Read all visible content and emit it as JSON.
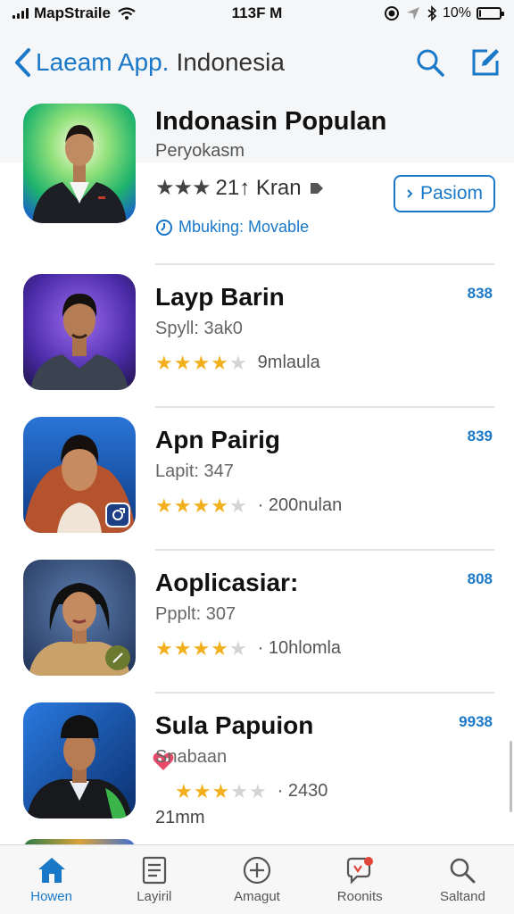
{
  "status_bar": {
    "carrier": "MapStraile",
    "time": "113F M",
    "battery": "10%",
    "battery_level": 0.1
  },
  "nav": {
    "back_label": "Laeam App.",
    "title": "Indonesia"
  },
  "featured": {
    "title": "Indonasin Populan",
    "subtitle": "Peryokasm",
    "rating_text": "21↑ Kran",
    "stars_filled": 3,
    "button_label": "Pasiom",
    "note": "Mbuking: Movable"
  },
  "apps": [
    {
      "title": "Layp Barin",
      "subtitle": "Spyll: 3ak0",
      "stars": 4,
      "count": "9mlaula",
      "price": "838"
    },
    {
      "title": "Apn Pairig",
      "subtitle": "Lapit: 347",
      "stars": 4,
      "count": "· 200nulan",
      "price": "839"
    },
    {
      "title": "Aoplicasiar:",
      "subtitle": "Ppplt: 307",
      "stars": 4,
      "count": "· 10hlomla",
      "price": "808"
    },
    {
      "title": "Sula Papuion",
      "subtitle": "Snabaan",
      "stars": 3,
      "count": "· 2430",
      "price": "9938",
      "extra": "21mm"
    }
  ],
  "tabs": [
    {
      "label": "Howen",
      "icon": "home-icon",
      "active": true
    },
    {
      "label": "Layiril",
      "icon": "list-icon",
      "active": false
    },
    {
      "label": "Amagut",
      "icon": "plus-circle-icon",
      "active": false
    },
    {
      "label": "Roonits",
      "icon": "chat-icon",
      "active": false
    },
    {
      "label": "Saltand",
      "icon": "search-icon",
      "active": false
    }
  ],
  "colors": {
    "accent": "#1a78c9",
    "star": "#f2b01e"
  }
}
